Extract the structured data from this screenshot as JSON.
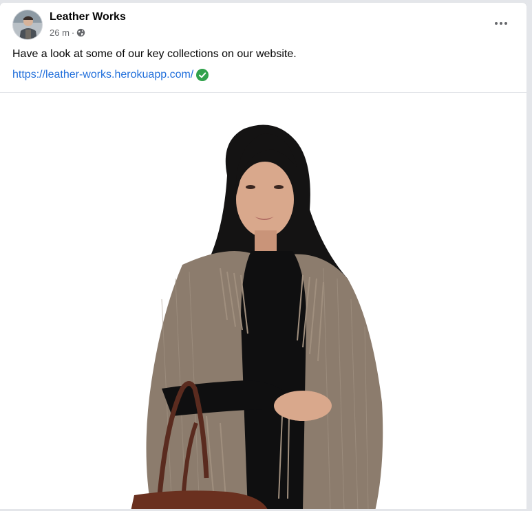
{
  "post": {
    "author": "Leather Works",
    "time": "26 m",
    "separator": "·",
    "text": "Have a look at some of our key collections on our website.",
    "link": "https://leather-works.herokuapp.com/"
  },
  "icons": {
    "privacy": "globe-icon",
    "verified": "check-circle-icon",
    "options": "more-horizontal-icon"
  },
  "colors": {
    "link": "#216fdb",
    "verified": "#31a24c",
    "secondary_text": "#65676b",
    "primary_text": "#050505"
  }
}
